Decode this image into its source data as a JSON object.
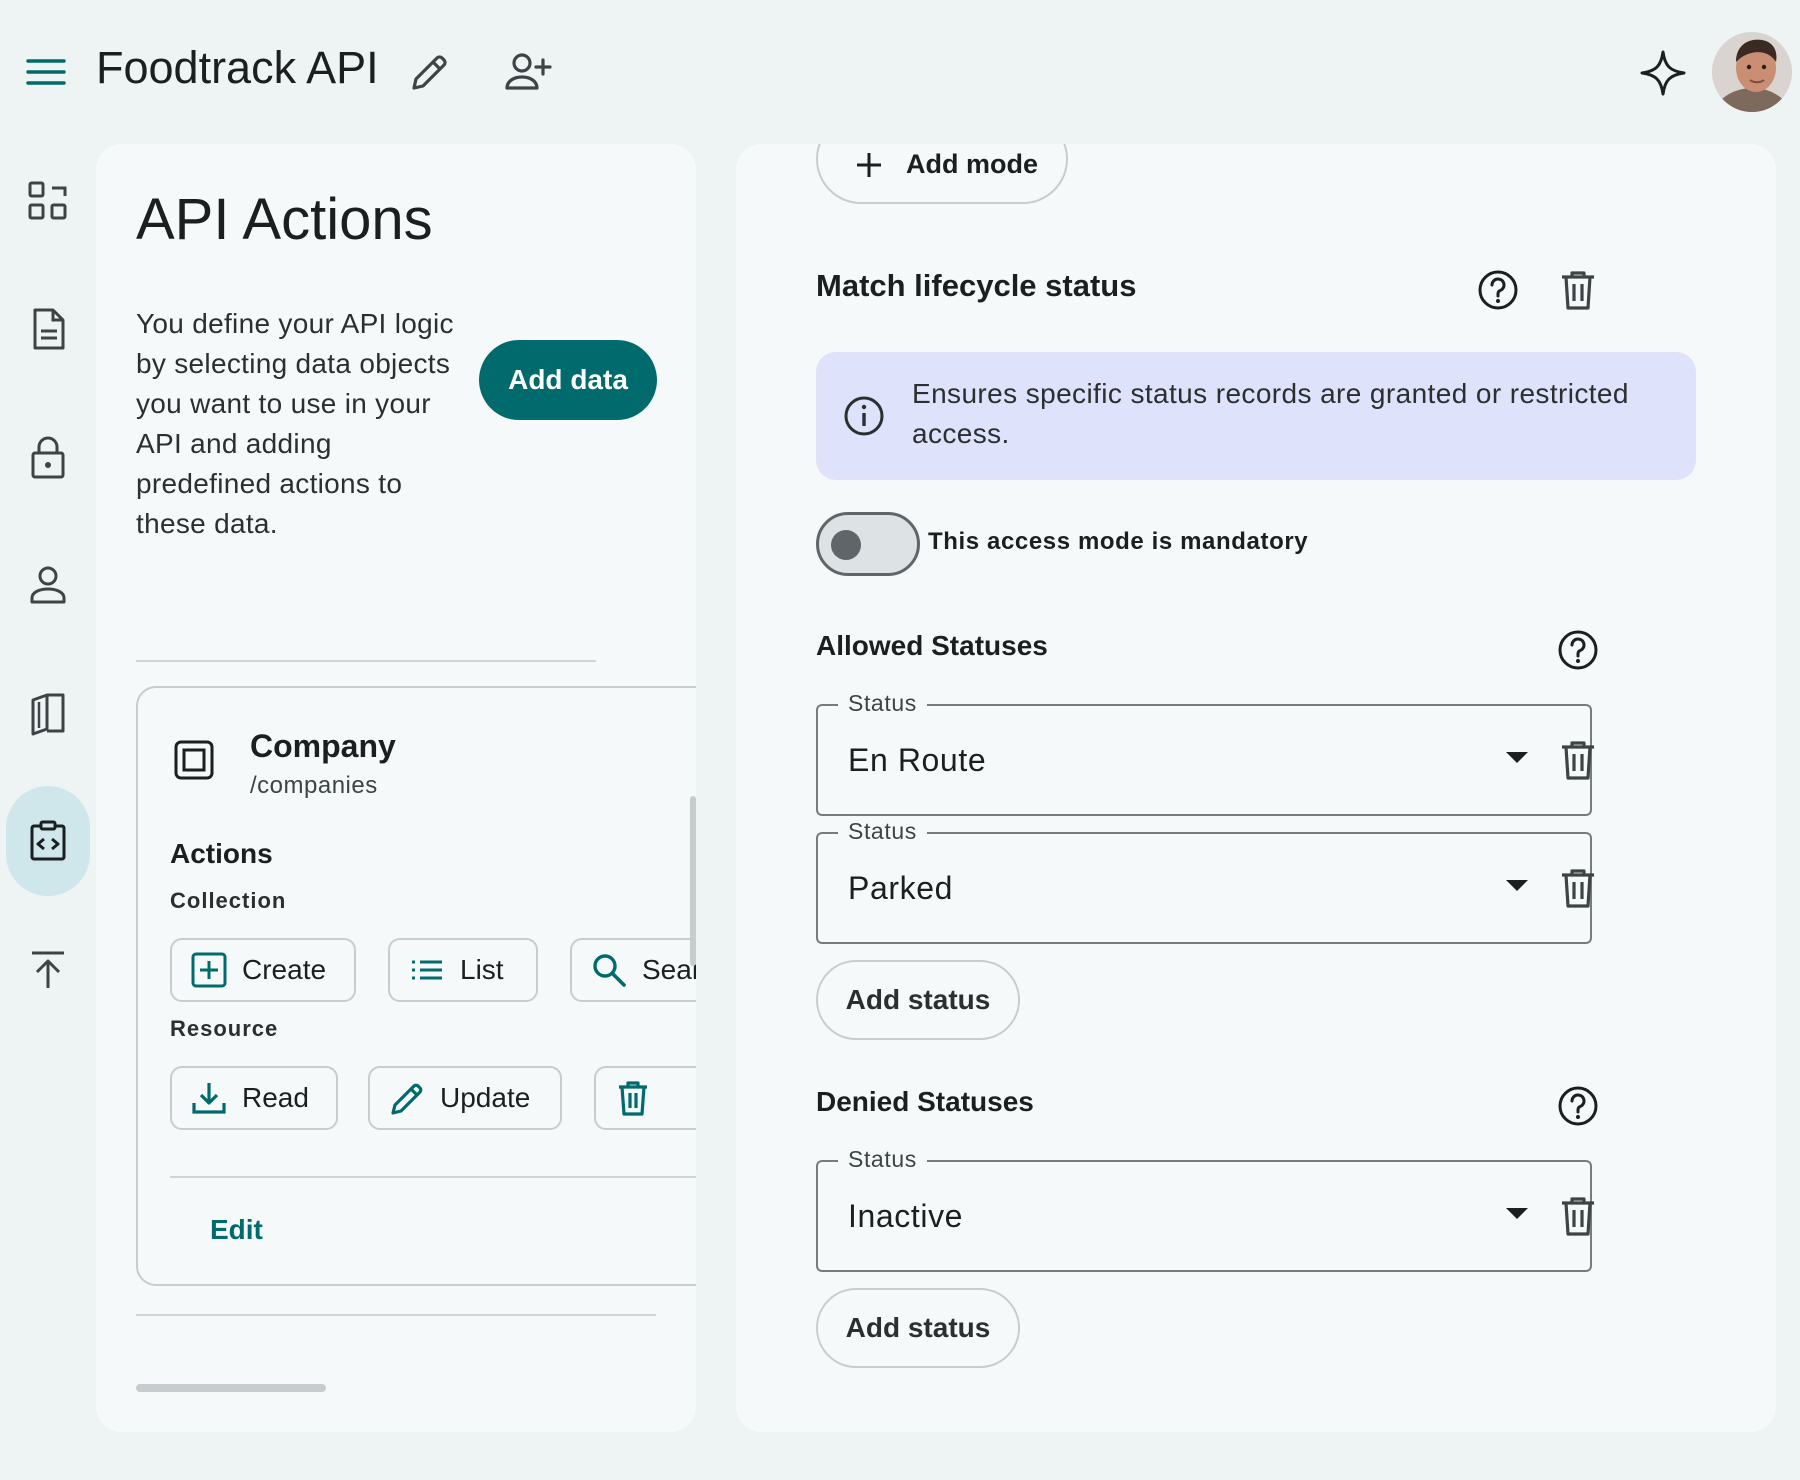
{
  "header": {
    "app_title": "Foodtrack API"
  },
  "sidebar": {
    "items": [
      {
        "name": "overview",
        "icon": "dashboard-icon"
      },
      {
        "name": "documents",
        "icon": "document-icon"
      },
      {
        "name": "security",
        "icon": "lock-icon"
      },
      {
        "name": "users",
        "icon": "person-icon"
      },
      {
        "name": "library",
        "icon": "book-icon"
      },
      {
        "name": "api-actions",
        "icon": "code-clipboard-icon",
        "active": true
      },
      {
        "name": "publish",
        "icon": "upload-icon"
      }
    ]
  },
  "left_panel": {
    "title": "API Actions",
    "intro": "You define your API logic by selecting data objects you want to use in your API and adding predefined actions to these data.",
    "add_data_label": "Add data",
    "entity": {
      "name": "Company",
      "path": "/companies",
      "actions_heading": "Actions",
      "collection_label": "Collection",
      "collection_actions": [
        {
          "label": "Create",
          "icon": "add-box-icon"
        },
        {
          "label": "List",
          "icon": "list-icon"
        },
        {
          "label": "Search",
          "icon": "search-icon"
        }
      ],
      "resource_label": "Resource",
      "resource_actions": [
        {
          "label": "Read",
          "icon": "download-icon"
        },
        {
          "label": "Update",
          "icon": "pencil-icon"
        },
        {
          "label": "",
          "icon": "trash-icon"
        }
      ],
      "edit_label": "Edit"
    }
  },
  "right_panel": {
    "add_mode_label": "Add mode",
    "match_heading": "Match lifecycle status",
    "info_text": "Ensures specific status records are granted or restricted access.",
    "mandatory_label": "This access mode is mandatory",
    "mandatory_on": false,
    "allowed_heading": "Allowed Statuses",
    "allowed": [
      {
        "label": "Status",
        "value": "En Route"
      },
      {
        "label": "Status",
        "value": "Parked"
      }
    ],
    "denied_heading": "Denied Statuses",
    "denied": [
      {
        "label": "Status",
        "value": "Inactive"
      }
    ],
    "add_status_label": "Add status"
  },
  "colors": {
    "primary": "#006a6d",
    "background": "#eef3f4",
    "surface": "#f6f9f9",
    "info_banner": "#dee2fb",
    "rail_active": "#cfe6ea"
  }
}
